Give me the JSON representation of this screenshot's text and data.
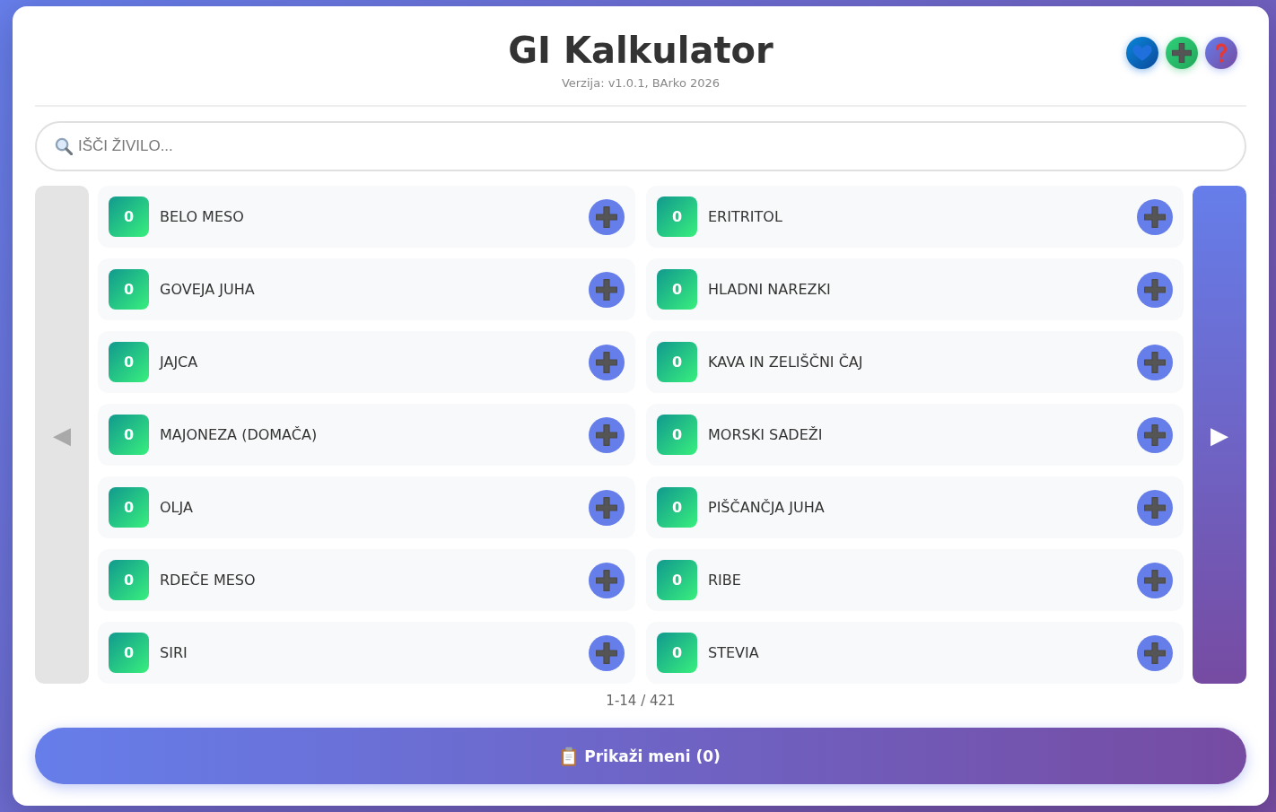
{
  "header": {
    "title": "GI Kalkulator",
    "subtitle": "Verzija: v1.0.1, BArko 2026",
    "actions": [
      {
        "kind": "favorites"
      },
      {
        "kind": "add"
      },
      {
        "kind": "help"
      }
    ]
  },
  "search": {
    "placeholder": "IŠČI ŽIVILO..."
  },
  "pager": {
    "prev": {
      "label": "◀",
      "disabled": true
    },
    "next": {
      "label": "▶",
      "disabled": false
    },
    "range": "1-14 / 421"
  },
  "foods": [
    {
      "name": "BELO MESO",
      "gi": "0"
    },
    {
      "name": "ERITRITOL",
      "gi": "0"
    },
    {
      "name": "GOVEJA JUHA",
      "gi": "0"
    },
    {
      "name": "HLADNI NAREZKI",
      "gi": "0"
    },
    {
      "name": "JAJCA",
      "gi": "0"
    },
    {
      "name": "KAVA IN ZELIŠČNI ČAJ",
      "gi": "0"
    },
    {
      "name": "MAJONEZA (DOMAČA)",
      "gi": "0"
    },
    {
      "name": "MORSKI SADEŽI",
      "gi": "0"
    },
    {
      "name": "OLJA",
      "gi": "0"
    },
    {
      "name": "PIŠČANČJA JUHA",
      "gi": "0"
    },
    {
      "name": "RDEČE MESO",
      "gi": "0"
    },
    {
      "name": "RIBE",
      "gi": "0"
    },
    {
      "name": "SIRI",
      "gi": "0"
    },
    {
      "name": "STEVIA",
      "gi": "0"
    }
  ],
  "menu_button": {
    "label": "Prikaži meni (0)"
  }
}
